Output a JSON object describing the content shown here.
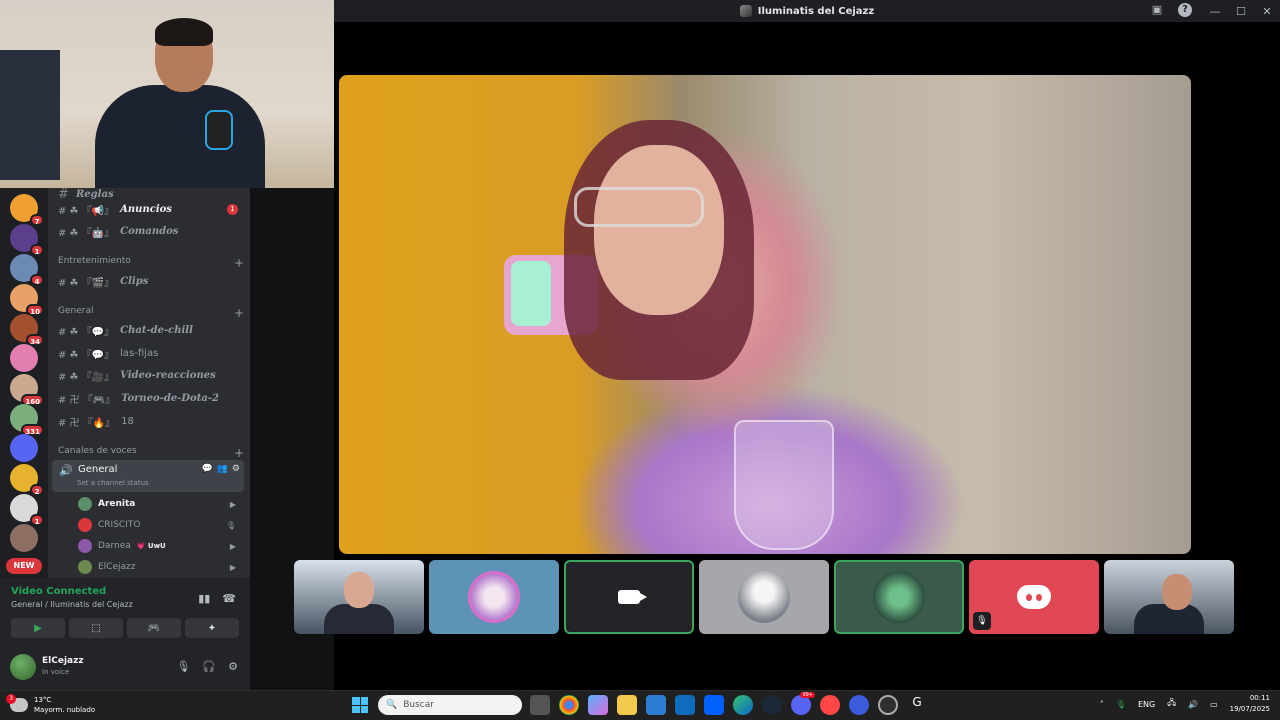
{
  "window": {
    "title": "Iluminatis del Cejazz",
    "controls": [
      "—",
      "☐",
      "✕"
    ]
  },
  "servers": [
    {
      "badge": "7",
      "color": "#f0a030"
    },
    {
      "badge": "1",
      "color": "#5b3f8c"
    },
    {
      "badge": "4",
      "color": "#6d89b5"
    },
    {
      "badge": "10",
      "color": "#e8a169"
    },
    {
      "badge": "34",
      "color": "#a3512e"
    },
    {
      "badge": "",
      "color": "#e37fb0"
    },
    {
      "badge": "160",
      "color": "#c9a98f"
    },
    {
      "badge": "331",
      "color": "#7aaf7d"
    },
    {
      "badge": "",
      "color": "#5865f2"
    },
    {
      "badge": "2",
      "color": "#e6b22f"
    },
    {
      "badge": "1",
      "color": "#d9d9d9"
    },
    {
      "badge": "",
      "color": "#8d6e63"
    }
  ],
  "new_label": "NEW",
  "channels": {
    "top_partial": "Reglas",
    "items": [
      {
        "prefix": "# ☘ 『📢』",
        "name": "Anuncios",
        "badge": "1",
        "bright": true
      },
      {
        "prefix": "# ☘ 『🤖』",
        "name": "Comandos",
        "badge": "",
        "bright": false
      }
    ],
    "cat_entretenimiento": "Entretenimiento",
    "entretenimiento": [
      {
        "prefix": "# ☘ 『🎬』",
        "name": "Clips"
      }
    ],
    "cat_general": "General",
    "general": [
      {
        "prefix": "# ☘ 『💬』",
        "name": "Chat-de-chill"
      },
      {
        "prefix": "# ☘ 『💬』",
        "name": "las-fijas"
      },
      {
        "prefix": "# ☘ 『🎥』",
        "name": "Video-reacciones"
      },
      {
        "prefix": "# 卍 『🎮』",
        "name": "Torneo-de-Dota-2"
      },
      {
        "prefix": "# 卍 『🔥』",
        "name": "18"
      }
    ],
    "cat_voces": "Canales de voces",
    "voice_channel": {
      "name": "General",
      "status": "Set a channel status"
    },
    "voice_users": [
      {
        "name": "Arenita",
        "tag": "",
        "bright": true,
        "color": "#5a8f6a",
        "right": "▶"
      },
      {
        "name": "CRISCITO",
        "tag": "",
        "bright": false,
        "color": "#da373c",
        "right": "🎙"
      },
      {
        "name": "Darnea",
        "tag": "💗 UwU",
        "bright": false,
        "color": "#8e5aa8",
        "right": "▶"
      },
      {
        "name": "ElCejazz",
        "tag": "",
        "bright": false,
        "color": "#6a8a4f",
        "right": "▶"
      }
    ]
  },
  "voice_panel": {
    "title": "Video Connected",
    "subtitle": "General / Iluminatis del Cejazz"
  },
  "user": {
    "name": "ElCejazz",
    "state": "In voice"
  },
  "taskbar": {
    "temp": "13°C",
    "weather": "Mayorm. nublado",
    "weather_badge": "3",
    "search_placeholder": "Buscar",
    "lang": "ENG",
    "time": "00:11",
    "date": "19/07/2025",
    "discord_badge": "99+"
  }
}
